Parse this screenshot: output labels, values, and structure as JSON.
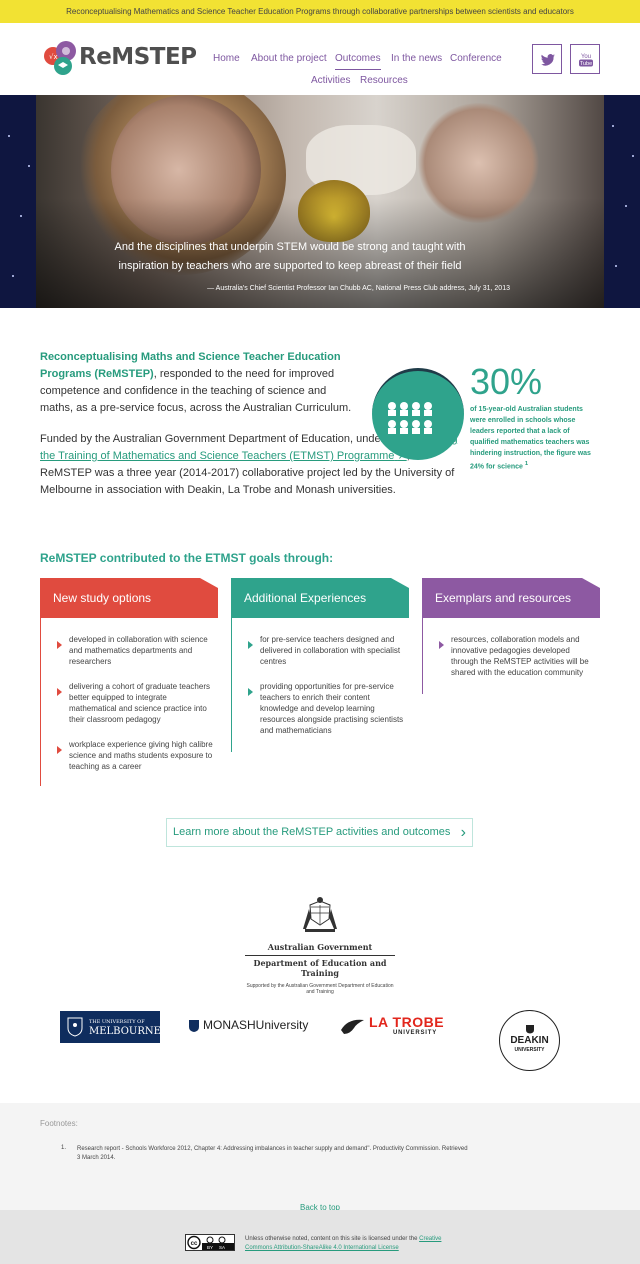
{
  "topbar": "Reconceptualising Mathematics and Science Teacher Education Programs through collaborative partnerships between scientists and educators",
  "logo": {
    "text": "ReMSTEP",
    "icon": "remstep-logo"
  },
  "nav": [
    "Home",
    "About the project",
    "Outcomes",
    "In the news",
    "Conference",
    "Activities",
    "Resources"
  ],
  "social": [
    {
      "name": "twitter-icon",
      "label": ""
    },
    {
      "name": "youtube-icon",
      "label": "You Tube"
    }
  ],
  "hero": {
    "quote": "And the disciplines that underpin STEM would be strong and taught with inspiration by teachers who are supported to keep abreast of their field",
    "cite": "— Australia's Chief Scientist Professor Ian Chubb AC, National Press Club address, July 31, 2013"
  },
  "intro": {
    "p1_bold": "Reconceptualising Maths and Science Teacher Education Programs (ReMSTEP)",
    "p1_rest": ", responded to the need for improved competence and confidence in the teaching of science and maths, as a pre-service focus, across the Australian Curriculum.",
    "p2_a": "Funded by the Australian Government Department of Education, under the ",
    "p2_link": "Enhancing the Training of Mathematics and Science Teachers (ETMST) Programme",
    "p2_b": ", ReMSTEP was a three year (2014-2017) collaborative project led by the University of Melbourne in association with Deakin, La Trobe and Monash universities."
  },
  "stat": {
    "value": "30%",
    "text": "of 15-year-old Australian students were enrolled in schools whose leaders reported that a lack of qualified mathematics teachers was hindering instruction, the figure was 24% for science",
    "sup": "1"
  },
  "goals": {
    "title": "ReMSTEP contributed to the ETMST goals through:",
    "cards": [
      {
        "title": "New study options",
        "color": "#e04b3f",
        "items": [
          "developed in collaboration with science and mathematics departments and researchers",
          "delivering a cohort of graduate teachers better equipped to integrate mathematical and science practice into their classroom pedagogy",
          "workplace experience giving high calibre science and maths students exposure to teaching as a career"
        ]
      },
      {
        "title": "Additional Experiences",
        "color": "#2fa38c",
        "items": [
          "for pre-service teachers designed and delivered in collaboration with specialist centres",
          "providing opportunities for pre-service teachers to enrich their content knowledge and develop learning resources alongside practising scientists and mathematicians"
        ]
      },
      {
        "title": "Exemplars and resources",
        "color": "#8d59a2",
        "items": [
          "resources, collaboration models and innovative pedagogies developed through the ReMSTEP activities will be shared with the education community"
        ]
      }
    ]
  },
  "learn_more": "Learn more about the ReMSTEP activities and outcomes",
  "gov": {
    "name": "Australian Government",
    "dept": "Department of Education and Training",
    "support": "Supported by the Australian Government Department of Education and Training"
  },
  "unis": {
    "melbourne_top": "THE UNIVERSITY OF",
    "melbourne": "MELBOURNE",
    "monash_bold": "MONASH",
    "monash_rest": "University",
    "latrobe": "LA TROBE",
    "latrobe_sub": "UNIVERSITY",
    "deakin": "DEAKIN",
    "deakin_sub": "UNIVERSITY"
  },
  "footnotes": {
    "label": "Footnotes:",
    "number": "1.",
    "text": "Research report - Schools Workforce 2012, Chapter 4: Addressing imbalances in teacher supply and demand\". Productivity Commission. Retrieved 3 March 2014."
  },
  "back_to_top": "Back to top",
  "footer": {
    "text": "Unless otherwise noted, content on this site is licensed under the ",
    "link": "Creative Commons Attribution-ShareAlike 4.0 International License",
    "cc_label": "cc",
    "by_label": "BY",
    "sa_label": "SA"
  }
}
